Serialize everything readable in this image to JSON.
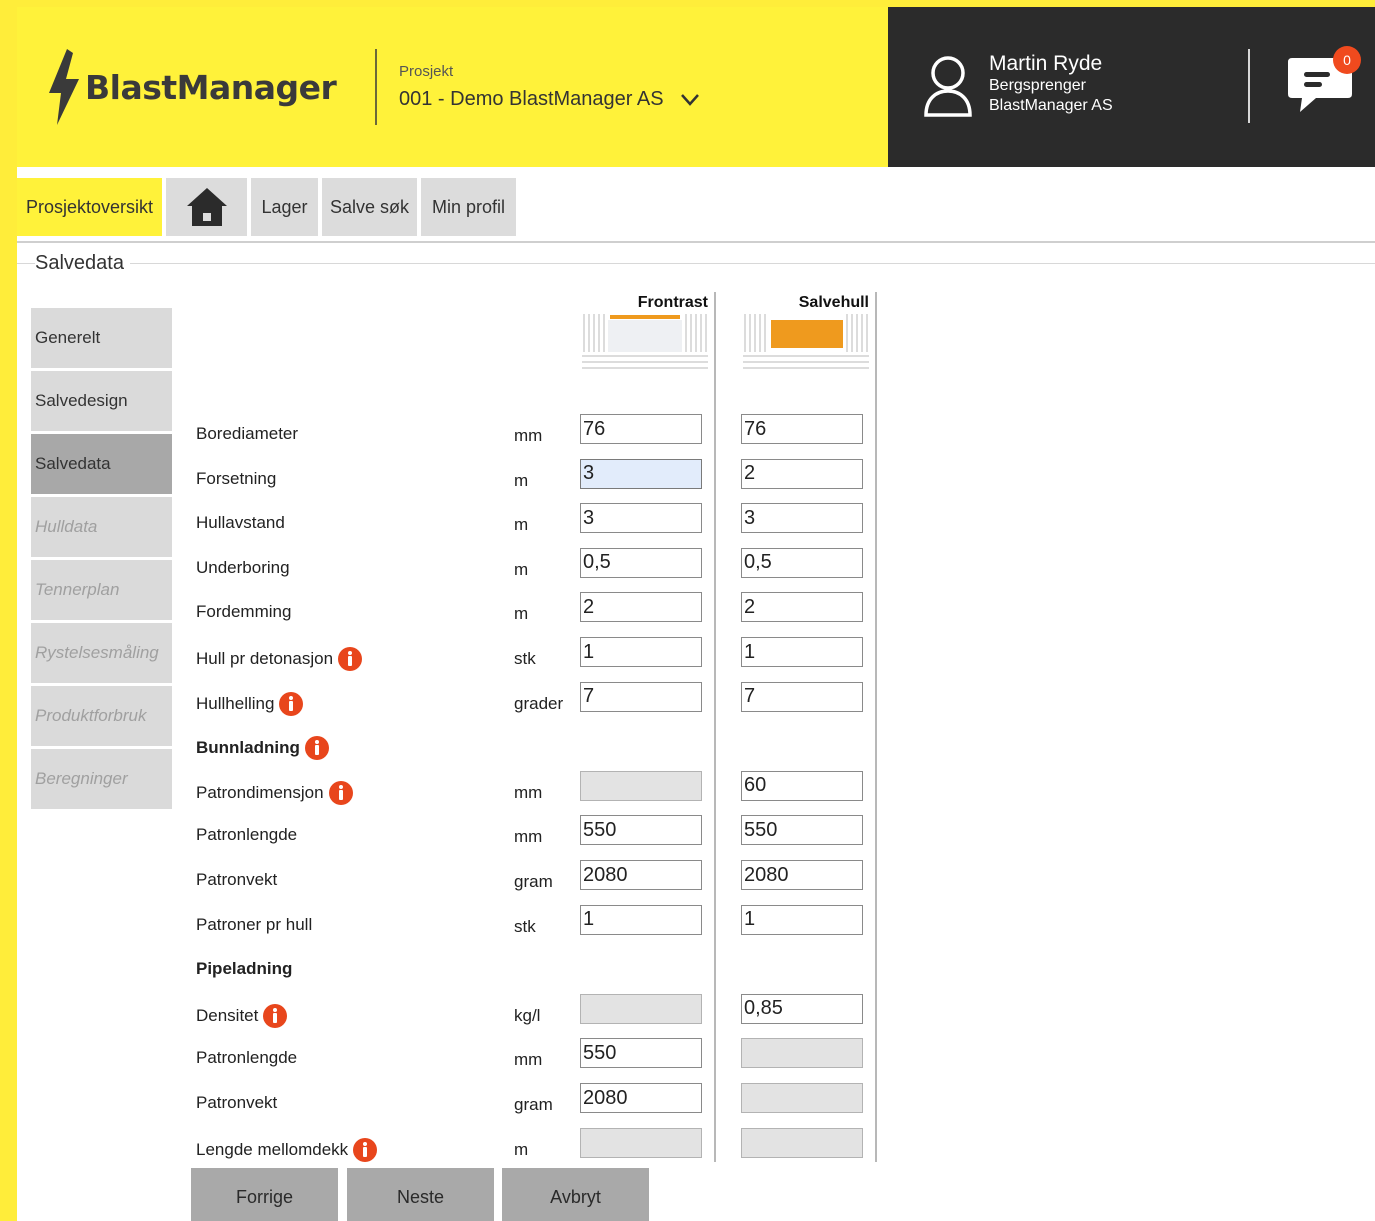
{
  "header": {
    "logo_text": "BlastManager",
    "project_label": "Prosjekt",
    "project_value": "001 - Demo BlastManager AS",
    "user": {
      "name": "Martin Ryde",
      "role": "Bergsprenger",
      "company": "BlastManager AS"
    },
    "chat_badge": "0"
  },
  "nav": {
    "items": [
      "Prosjektoversikt",
      "Lager",
      "Salve søk",
      "Min profil"
    ],
    "active": "Prosjektoversikt"
  },
  "section_title": "Salvedata",
  "sidebar": {
    "items": [
      {
        "label": "Generelt",
        "state": "normal"
      },
      {
        "label": "Salvedesign",
        "state": "normal"
      },
      {
        "label": "Salvedata",
        "state": "active"
      },
      {
        "label": "Hulldata",
        "state": "disabled"
      },
      {
        "label": "Tennerplan",
        "state": "disabled"
      },
      {
        "label": "Rystelsesmåling",
        "state": "disabled"
      },
      {
        "label": "Produktforbruk",
        "state": "disabled"
      },
      {
        "label": "Beregninger",
        "state": "disabled"
      }
    ]
  },
  "columns": [
    "Frontrast",
    "Salvehull"
  ],
  "rows": [
    {
      "label": "Borediameter",
      "unit": "mm",
      "front": "76",
      "salve": "76"
    },
    {
      "label": "Forsetning",
      "unit": "m",
      "front": "3",
      "salve": "2"
    },
    {
      "label": "Hullavstand",
      "unit": "m",
      "front": "3",
      "salve": "3"
    },
    {
      "label": "Underboring",
      "unit": "m",
      "front": "0,5",
      "salve": "0,5"
    },
    {
      "label": "Fordemming",
      "unit": "m",
      "front": "2",
      "salve": "2"
    },
    {
      "label": "Hull pr detonasjon",
      "unit": "stk",
      "front": "1",
      "salve": "1"
    },
    {
      "label": "Hullhelling",
      "unit": "grader",
      "front": "7",
      "salve": "7"
    },
    {
      "label": "Bunnladning"
    },
    {
      "label": "Patrondimensjon",
      "unit": "mm",
      "front": "",
      "salve": "60"
    },
    {
      "label": "Patronlengde",
      "unit": "mm",
      "front": "550",
      "salve": "550"
    },
    {
      "label": "Patronvekt",
      "unit": "gram",
      "front": "2080",
      "salve": "2080"
    },
    {
      "label": "Patroner pr hull",
      "unit": "stk",
      "front": "1",
      "salve": "1"
    },
    {
      "label": "Pipeladning"
    },
    {
      "label": "Densitet",
      "unit": "kg/l",
      "front": "",
      "salve": "0,85"
    },
    {
      "label": "Patronlengde",
      "unit": "mm",
      "front": "550",
      "salve": ""
    },
    {
      "label": "Patronvekt",
      "unit": "gram",
      "front": "2080",
      "salve": ""
    },
    {
      "label": "Lengde mellomdekk",
      "unit": "m",
      "front": "",
      "salve": ""
    }
  ],
  "buttons": {
    "prev": "Forrige",
    "next": "Neste",
    "cancel": "Avbryt"
  },
  "colors": {
    "brand_yellow": "#fff23a",
    "dark": "#2b2b2b",
    "info_orange": "#e8461c",
    "charge_orange": "#ef9a1e"
  }
}
